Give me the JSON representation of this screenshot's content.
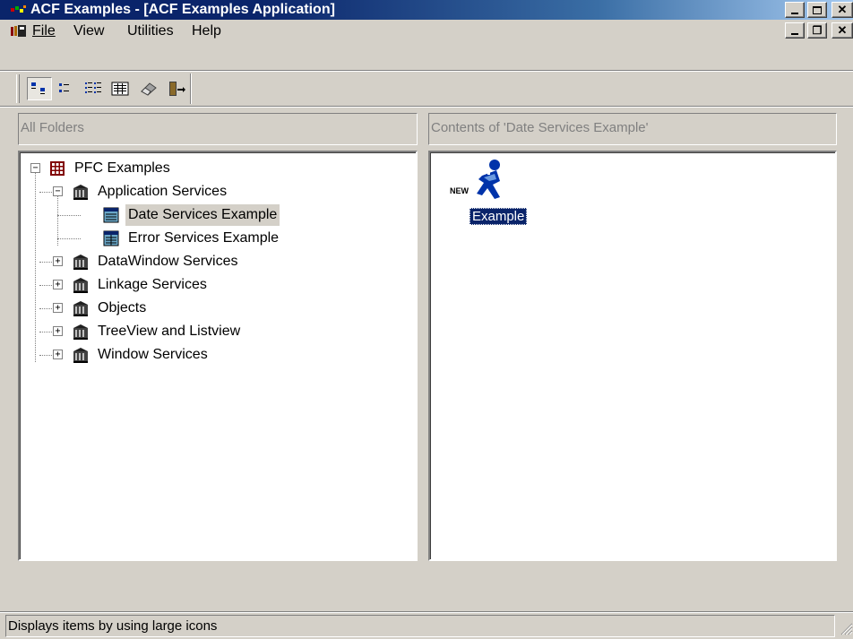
{
  "window": {
    "title": "ACF Examples - [ACF Examples Application]"
  },
  "menu": {
    "file": "File",
    "view": "View",
    "utilities": "Utilities",
    "help": "Help"
  },
  "toolbar": {
    "buttons": [
      {
        "icon": "large-icons-view-icon",
        "pressed": true
      },
      {
        "icon": "small-icons-view-icon",
        "pressed": false
      },
      {
        "icon": "list-view-icon",
        "pressed": false
      },
      {
        "icon": "details-view-icon",
        "pressed": false
      },
      {
        "icon": "eraser-icon",
        "pressed": false
      },
      {
        "icon": "exit-door-icon",
        "pressed": false
      }
    ]
  },
  "left_panel": {
    "header": "All Folders",
    "tree": [
      {
        "label": "PFC Examples",
        "level": 0,
        "expander": "−",
        "icon": "grid-icon"
      },
      {
        "label": "Application Services",
        "level": 1,
        "expander": "−",
        "icon": "library-icon"
      },
      {
        "label": "Date Services Example",
        "level": 2,
        "expander": "",
        "icon": "window-icon",
        "selected": true
      },
      {
        "label": "Error Services Example",
        "level": 2,
        "expander": "",
        "icon": "window-icon"
      },
      {
        "label": "DataWindow Services",
        "level": 1,
        "expander": "+",
        "icon": "library-icon"
      },
      {
        "label": "Linkage Services",
        "level": 1,
        "expander": "+",
        "icon": "library-icon"
      },
      {
        "label": "Objects",
        "level": 1,
        "expander": "+",
        "icon": "library-icon"
      },
      {
        "label": "TreeView and Listview",
        "level": 1,
        "expander": "+",
        "icon": "library-icon"
      },
      {
        "label": "Window Services",
        "level": 1,
        "expander": "+",
        "icon": "library-icon"
      }
    ]
  },
  "right_panel": {
    "header": "Contents of 'Date Services Example'",
    "items": [
      {
        "label": "Example",
        "badge": "NEW",
        "icon": "running-man-icon",
        "selected": true
      }
    ]
  },
  "status": {
    "text": "Displays items by using large icons"
  },
  "colors": {
    "face": "#d4d0c8",
    "title_active": "#0a246a",
    "selection": "#0a246a"
  }
}
